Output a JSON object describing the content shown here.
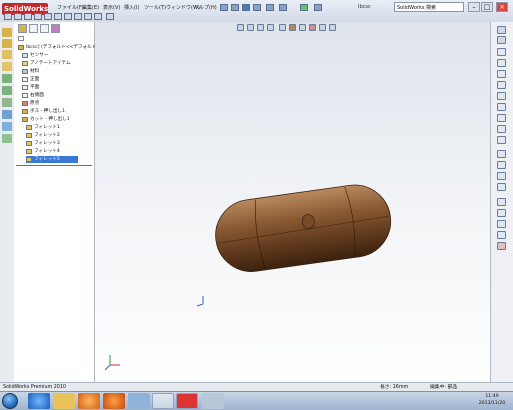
{
  "app": {
    "logo_text": "SolidWorks",
    "filename": "Ibcsc",
    "search_placeholder": "SolidWorks 検索"
  },
  "menu": [
    "ファイル(F)",
    "編集(E)",
    "表示(V)",
    "挿入(I)",
    "ツール(T)",
    "ウィンドウ(W)",
    "ヘルプ(H)"
  ],
  "feature_tree": {
    "root": "Ibcsc] (デフォルト<<デフォルト>_表",
    "items": [
      {
        "label": "センサー",
        "icon": "sensor-icon"
      },
      {
        "label": "アノテートアイテム",
        "icon": "annotation-icon"
      },
      {
        "label": "材料",
        "icon": "material-icon"
      },
      {
        "label": "正面",
        "icon": "plane-icon"
      },
      {
        "label": "平面",
        "icon": "plane-icon"
      },
      {
        "label": "右側面",
        "icon": "plane-icon"
      },
      {
        "label": "原点",
        "icon": "origin-icon"
      },
      {
        "label": "ボス - 押し出し1",
        "icon": "extrude-icon"
      },
      {
        "label": "カット - 押し出し1",
        "icon": "cut-icon"
      },
      {
        "label": "フィレット1",
        "icon": "fillet-icon"
      },
      {
        "label": "フィレット2",
        "icon": "fillet-icon"
      },
      {
        "label": "フィレット3",
        "icon": "fillet-icon"
      },
      {
        "label": "フィレット4",
        "icon": "fillet-icon"
      },
      {
        "label": "フィレット5",
        "icon": "fillet-icon",
        "selected": true
      }
    ]
  },
  "status": {
    "left": "SolidWorks Premium 2010",
    "right1": "長さ: 16mm",
    "right2": "編集中: 部品"
  },
  "taskbar": {
    "time": "11:49",
    "date": "2013/11/20",
    "apps": [
      "ie-icon",
      "folder-icon",
      "media-icon",
      "firefox-icon",
      "mail-icon",
      "network-icon",
      "solidworks-icon",
      "app-icon"
    ]
  },
  "colors": {
    "accent": "#3a78d8",
    "brand": "#c3262b",
    "model_body": "#6b4226"
  }
}
